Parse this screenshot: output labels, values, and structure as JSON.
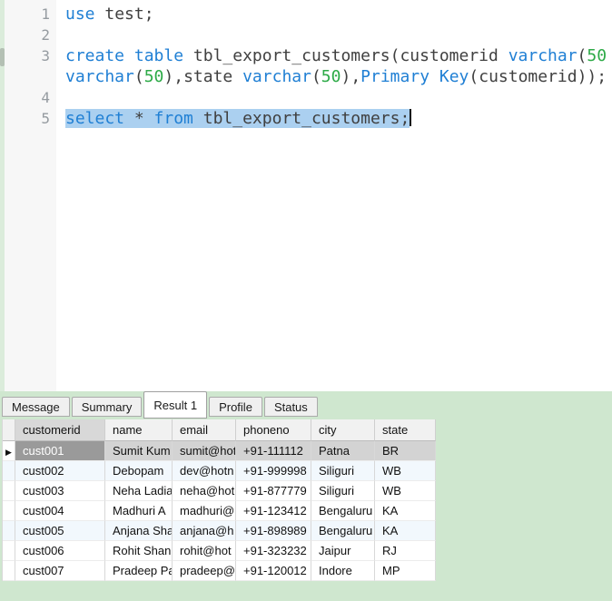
{
  "colors": {
    "window_green": "#cfe7cf",
    "keyword_blue": "#1f7fd4",
    "number_green": "#2daa47",
    "plain_text": "#404040",
    "selection_blue": "#abd0f0",
    "selected_cell_gray": "#9a9a9a",
    "selected_row_gray": "#d3d3d3"
  },
  "editor": {
    "gutter_numbers": [
      "1",
      "2",
      "3",
      "",
      "4",
      "5"
    ],
    "lines": [
      {
        "segments": [
          {
            "t": "use",
            "c": "kw"
          },
          {
            "t": " test;",
            "c": "plain"
          }
        ]
      },
      {
        "segments": []
      },
      {
        "segments": [
          {
            "t": "create",
            "c": "kw"
          },
          {
            "t": " ",
            "c": "plain"
          },
          {
            "t": "table",
            "c": "kw"
          },
          {
            "t": " tbl_export_customers(customerid ",
            "c": "plain"
          },
          {
            "t": "varchar",
            "c": "kw"
          },
          {
            "t": "(",
            "c": "plain"
          },
          {
            "t": "50",
            "c": "num"
          }
        ]
      },
      {
        "segments": [
          {
            "t": "varchar",
            "c": "kw"
          },
          {
            "t": "(",
            "c": "plain"
          },
          {
            "t": "50",
            "c": "num"
          },
          {
            "t": "),state ",
            "c": "plain"
          },
          {
            "t": "varchar",
            "c": "kw"
          },
          {
            "t": "(",
            "c": "plain"
          },
          {
            "t": "50",
            "c": "num"
          },
          {
            "t": "),",
            "c": "plain"
          },
          {
            "t": "Primary",
            "c": "kw"
          },
          {
            "t": " ",
            "c": "plain"
          },
          {
            "t": "Key",
            "c": "kw"
          },
          {
            "t": "(customerid));",
            "c": "plain"
          }
        ]
      },
      {
        "segments": []
      },
      {
        "selected": true,
        "cursor": true,
        "segments": [
          {
            "t": "select",
            "c": "kw"
          },
          {
            "t": " * ",
            "c": "plain"
          },
          {
            "t": "from",
            "c": "kw"
          },
          {
            "t": " tbl_export_customers;",
            "c": "plain"
          }
        ]
      }
    ]
  },
  "tabs": {
    "items": [
      {
        "label": "Message",
        "active": false
      },
      {
        "label": "Summary",
        "active": false
      },
      {
        "label": "Result 1",
        "active": true
      },
      {
        "label": "Profile",
        "active": false
      },
      {
        "label": "Status",
        "active": false
      }
    ]
  },
  "grid": {
    "columns": [
      "customerid",
      "name",
      "email",
      "phoneno",
      "city",
      "state"
    ],
    "rows": [
      {
        "selected": true,
        "cells": [
          "cust001",
          "Sumit Kum",
          "sumit@hot",
          "+91-111112",
          "Patna",
          "BR"
        ]
      },
      {
        "selected": false,
        "cells": [
          "cust002",
          "Debopam",
          "dev@hotn",
          "+91-999998",
          "Siliguri",
          "WB"
        ]
      },
      {
        "selected": false,
        "cells": [
          "cust003",
          "Neha Ladia",
          "neha@hot",
          "+91-877779",
          "Siliguri",
          "WB"
        ]
      },
      {
        "selected": false,
        "cells": [
          "cust004",
          "Madhuri A",
          "madhuri@",
          "+91-123412",
          "Bengaluru",
          "KA"
        ]
      },
      {
        "selected": false,
        "cells": [
          "cust005",
          "Anjana Sha",
          "anjana@h",
          "+91-898989",
          "Bengaluru",
          "KA"
        ]
      },
      {
        "selected": false,
        "cells": [
          "cust006",
          "Rohit Shan",
          "rohit@hot",
          "+91-323232",
          "Jaipur",
          "RJ"
        ]
      },
      {
        "selected": false,
        "cells": [
          "cust007",
          "Pradeep Pa",
          "pradeep@",
          "+91-120012",
          "Indore",
          "MP"
        ]
      }
    ],
    "row_marker_icon": "▶"
  }
}
